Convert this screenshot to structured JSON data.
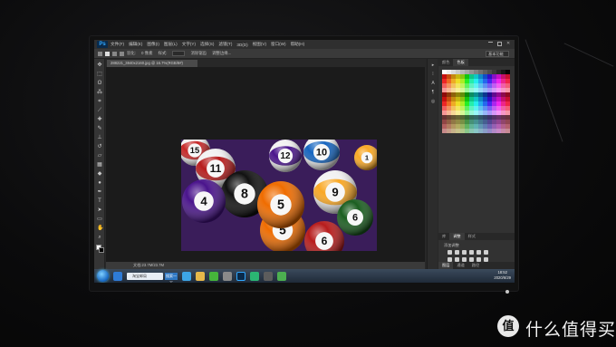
{
  "menubar": {
    "app_logo": "Ps",
    "items": [
      "文件(F)",
      "编辑(E)",
      "图像(I)",
      "图层(L)",
      "文字(Y)",
      "选择(S)",
      "滤镜(T)",
      "3D(D)",
      "视图(V)",
      "窗口(W)",
      "帮助(H)"
    ]
  },
  "options": {
    "feather_label": "羽化:",
    "feather_value": "0 像素",
    "style_label": "样式:",
    "style_value": "正常",
    "antialias": "消除锯齿",
    "refine": "调整边缘...",
    "workspace": "基本功能"
  },
  "document": {
    "tab_label": "288221_3840x2160.jpg @ 16.7%(RGB/8#)",
    "status": "文档:23.7M/23.7M"
  },
  "photo": {
    "balls": [
      {
        "num": "15",
        "color": "#c62828",
        "stripe": true
      },
      {
        "num": "11",
        "color": "#b71c1c",
        "stripe": true
      },
      {
        "num": "12",
        "color": "#4a148c",
        "stripe": true
      },
      {
        "num": "10",
        "color": "#1565c0",
        "stripe": true
      },
      {
        "num": "8",
        "color": "#111111",
        "stripe": false
      },
      {
        "num": "4",
        "color": "#4a148c",
        "stripe": false
      },
      {
        "num": "9",
        "color": "#f9a825",
        "stripe": true
      },
      {
        "num": "6",
        "color": "#1b5e20",
        "stripe": false
      },
      {
        "num": "5",
        "color": "#ef6c00",
        "stripe": false
      },
      {
        "num": "5",
        "color": "#ef6c00",
        "stripe": false
      },
      {
        "num": "6",
        "color": "#b71c1c",
        "stripe": false
      },
      {
        "num": "1",
        "color": "#f9a825",
        "stripe": false
      }
    ]
  },
  "right_panel": {
    "tabs_top": [
      "颜色",
      "色板"
    ],
    "tabs_bottom": [
      "库",
      "调整",
      "样式"
    ],
    "adjust_title": "添加调整",
    "tabs_layers": [
      "图层",
      "通道",
      "路径"
    ]
  },
  "taskbar": {
    "address_text": "淘宝邮局",
    "search_label": "搜索一下",
    "time": "18:52",
    "date": "2020/6/29"
  },
  "watermark": {
    "logo": "值",
    "text": "什么值得买"
  }
}
